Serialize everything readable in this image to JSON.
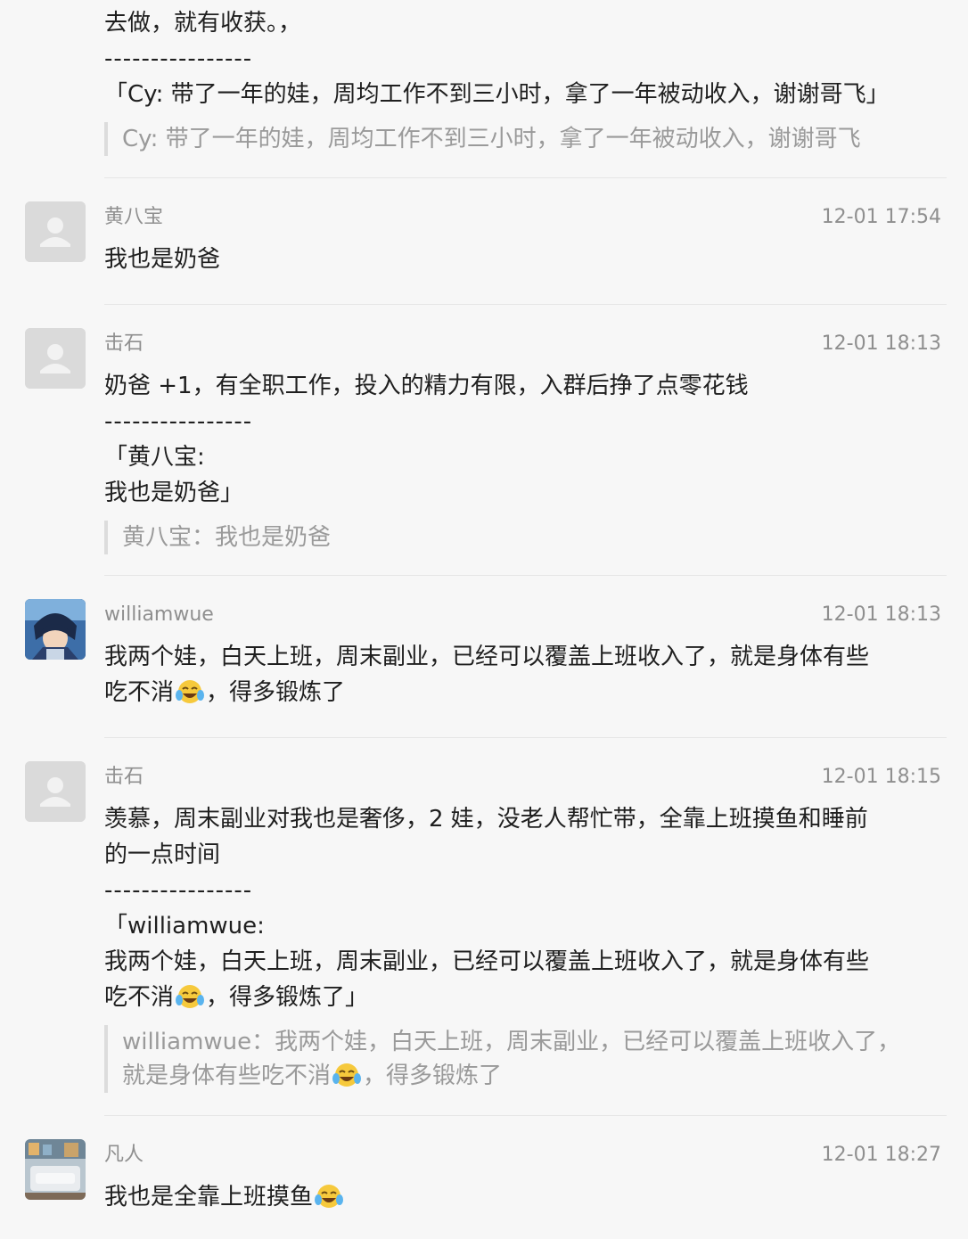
{
  "top_fragment": {
    "line1": "去做，就有收获。，",
    "divider": "----------------",
    "quoted": "「Cy: 带了一年的娃，周均工作不到三小时，拿了一年被动收入，谢谢哥飞」",
    "reply_quote": "Cy: 带了一年的娃，周均工作不到三小时，拿了一年被动收入，谢谢哥飞"
  },
  "comments": [
    {
      "author": "黄八宝",
      "time": "12-01 17:54",
      "avatar": "default-person-icon",
      "lines": [
        "我也是奶爸"
      ]
    },
    {
      "author": "击石",
      "time": "12-01 18:13",
      "avatar": "default-person-icon",
      "lines": [
        "奶爸 +1，有全职工作，投入的精力有限，入群后挣了点零花钱"
      ],
      "divider": "----------------",
      "quoted_lines": [
        "「黄八宝:",
        "我也是奶爸」"
      ],
      "reply_quote": "黄八宝：我也是奶爸"
    },
    {
      "author": "williamwue",
      "time": "12-01 18:13",
      "avatar": "anime-avatar-photo",
      "lines": [
        "我两个娃，白天上班，周末副业，已经可以覆盖上班收入了，就是身体有些",
        "吃不消",
        "，得多锻炼了"
      ]
    },
    {
      "author": "击石",
      "time": "12-01 18:15",
      "avatar": "default-person-icon",
      "lines": [
        "羡慕，周末副业对我也是奢侈，2 娃，没老人帮忙带，全靠上班摸鱼和睡前",
        "的一点时间"
      ],
      "divider": "----------------",
      "quoted_lines": [
        "「williamwue:",
        "我两个娃，白天上班，周末副业，已经可以覆盖上班收入了，就是身体有些",
        "吃不消",
        "，得多锻炼了」"
      ],
      "reply_quote": [
        "williamwue：我两个娃，白天上班，周末副业，已经可以覆盖上班收入了，",
        "就是身体有些吃不消",
        "，得多锻炼了"
      ]
    },
    {
      "author": "凡人",
      "time": "12-01 18:27",
      "avatar": "room-photo-avatar",
      "lines": [
        "我也是全靠上班摸鱼"
      ]
    }
  ],
  "emoji": "laughing-tears-emoji",
  "colors": {
    "background": "#f7f7f7",
    "meta_text": "#8f8f8f",
    "quote_bar": "#dcdcdc"
  }
}
